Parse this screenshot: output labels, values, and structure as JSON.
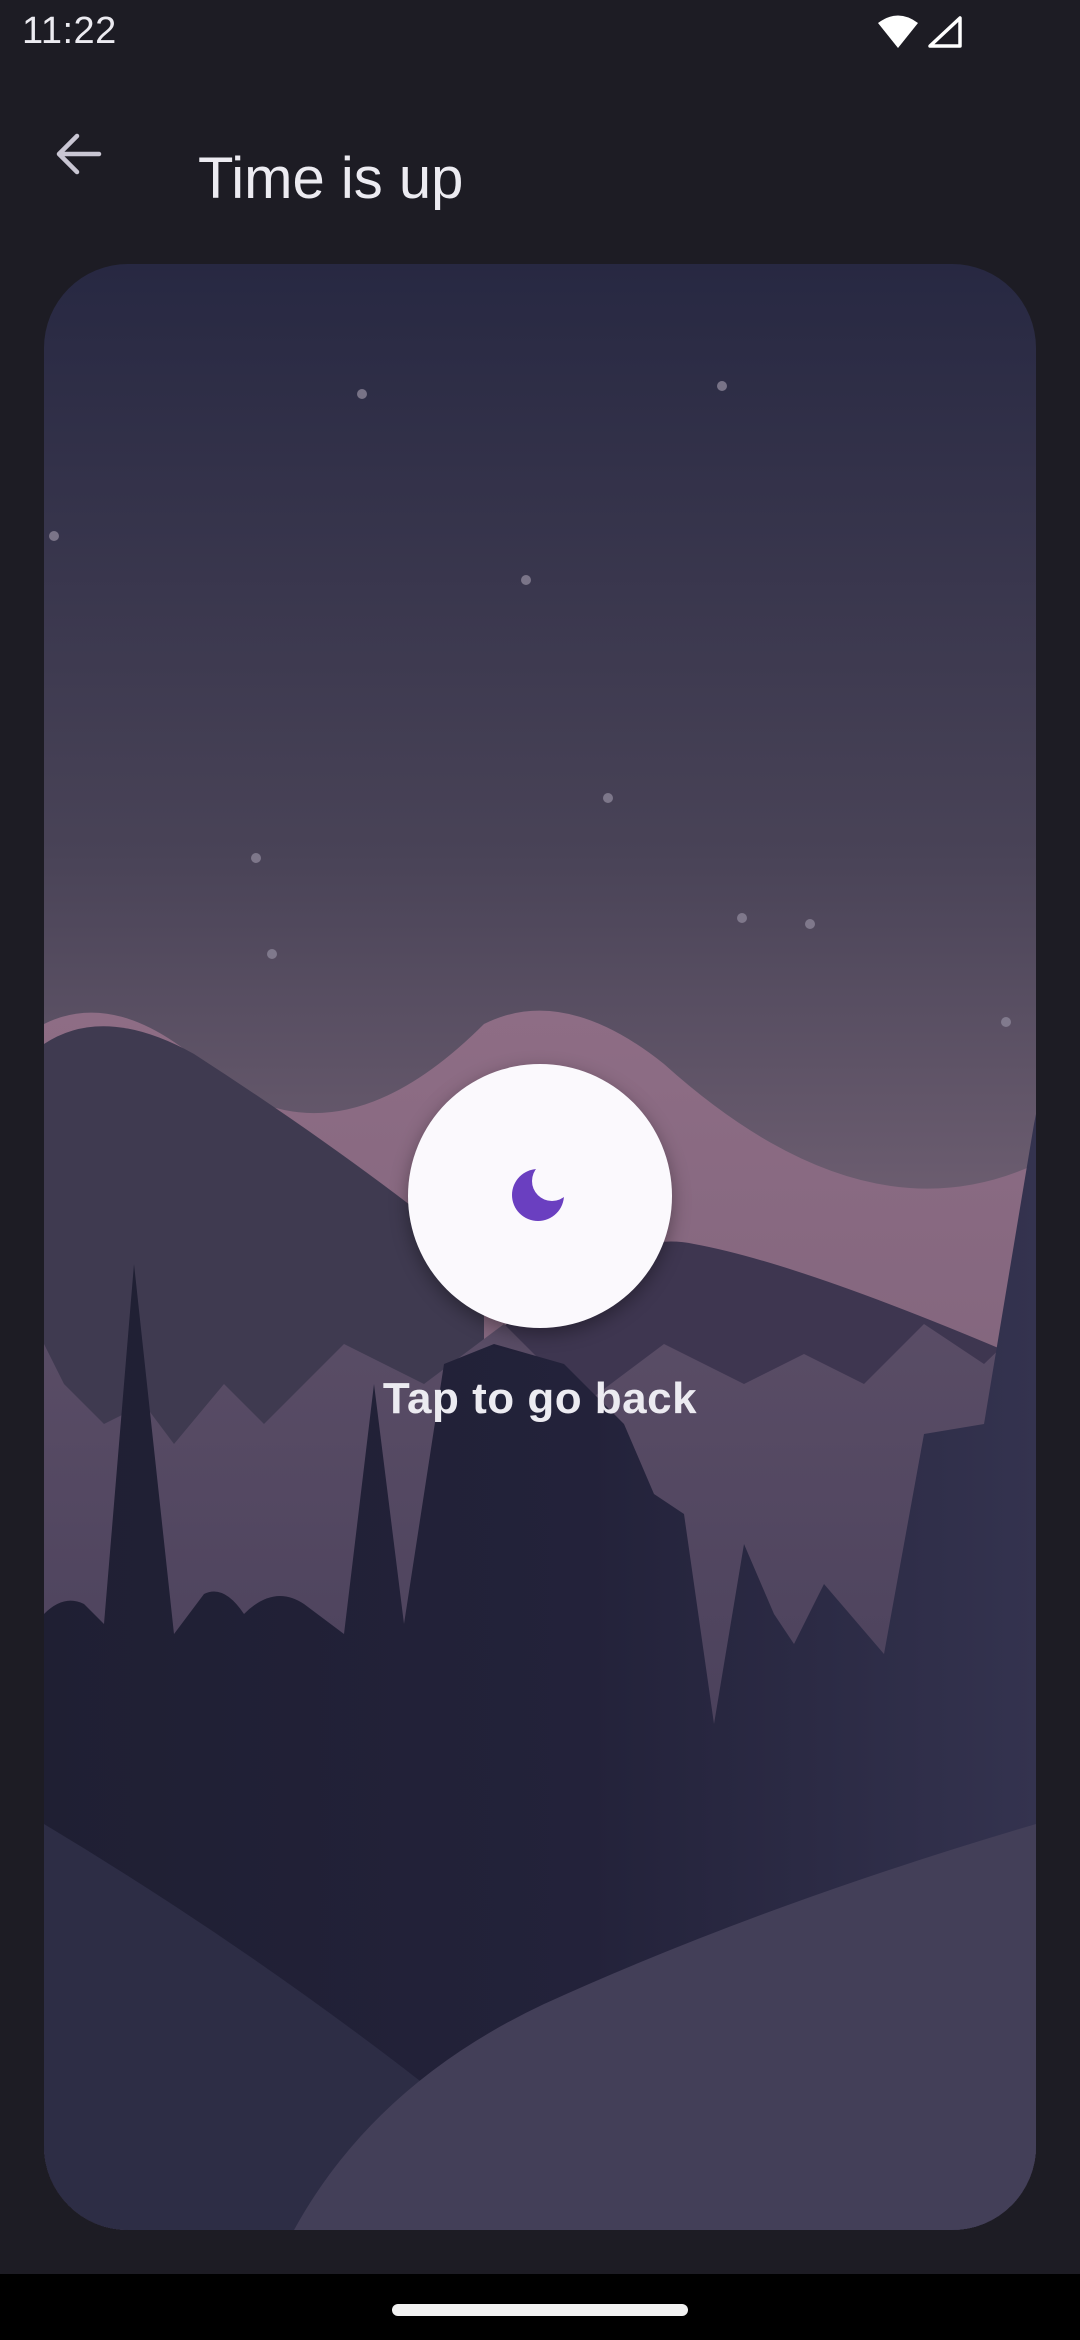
{
  "status_bar": {
    "time": "11:22",
    "icons": [
      "wifi-icon",
      "signal-icon"
    ]
  },
  "top_bar": {
    "back_icon": "arrow-back-icon",
    "title": "Time is up"
  },
  "card": {
    "caption": "Tap to go back",
    "moon_icon": "moon-icon",
    "colors": {
      "sky_top": "#2a2a44",
      "sky_bottom": "#857082",
      "moon_button": "#fbf9fd",
      "moon": "#6a3fc0"
    }
  }
}
